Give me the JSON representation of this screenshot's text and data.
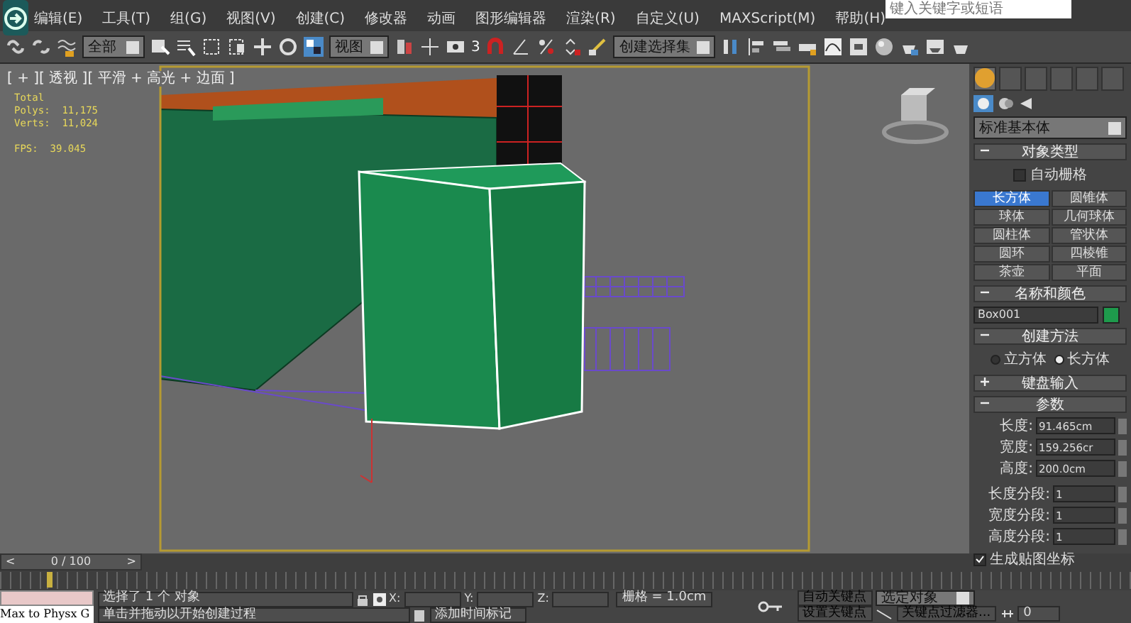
{
  "title_bar": {
    "search_placeholder": "键入关键字或短语"
  },
  "menu": [
    "编辑(E)",
    "工具(T)",
    "组(G)",
    "视图(V)",
    "创建(C)",
    "修改器",
    "动画",
    "图形编辑器",
    "渲染(R)",
    "自定义(U)",
    "MAXScript(M)",
    "帮助(H)"
  ],
  "toolbar": {
    "selection_filter": "全部",
    "reference_coord": "视图",
    "selection_set": "创建选择集",
    "snap_count": "3"
  },
  "viewport": {
    "label": "[ + ][ 透视 ][ 平滑 + 高光 + 边面 ]",
    "stats": [
      "Total",
      "Polys:  11,175",
      "Verts:  11,024"
    ],
    "fps": "FPS:  39.045"
  },
  "command_panel": {
    "category": "标准基本体",
    "object_type": {
      "title": "对象类型",
      "auto_grid": {
        "label": "自动栅格",
        "checked": false
      },
      "buttons": [
        {
          "label": "长方体",
          "selected": true
        },
        {
          "label": "圆锥体",
          "selected": false
        },
        {
          "label": "球体",
          "selected": false
        },
        {
          "label": "几何球体",
          "selected": false
        },
        {
          "label": "圆柱体",
          "selected": false
        },
        {
          "label": "管状体",
          "selected": false
        },
        {
          "label": "圆环",
          "selected": false
        },
        {
          "label": "四棱锥",
          "selected": false
        },
        {
          "label": "茶壶",
          "selected": false
        },
        {
          "label": "平面",
          "selected": false
        }
      ]
    },
    "name_color": {
      "title": "名称和颜色",
      "name": "Box001",
      "color": "#1e9a4c"
    },
    "creation_method": {
      "title": "创建方法",
      "options": [
        {
          "label": "立方体",
          "selected": false
        },
        {
          "label": "长方体",
          "selected": true
        }
      ]
    },
    "keyboard_entry": {
      "title": "键盘输入",
      "expanded": false
    },
    "parameters": {
      "title": "参数",
      "expanded": true,
      "fields": [
        {
          "label": "长度:",
          "value": "91.465cm"
        },
        {
          "label": "宽度:",
          "value": "159.256cr"
        },
        {
          "label": "高度:",
          "value": "200.0cm"
        }
      ],
      "segments": [
        {
          "label": "长度分段:",
          "value": "1"
        },
        {
          "label": "宽度分段:",
          "value": "1"
        },
        {
          "label": "高度分段:",
          "value": "1"
        }
      ],
      "gen_mapping": {
        "label": "生成贴图坐标",
        "checked": true
      }
    }
  },
  "timeline": {
    "position": "0 / 100",
    "level": 0,
    "prev": "<",
    "next": ">"
  },
  "status": {
    "script_output": "Max to Physx G",
    "selection": "选择了 1 个 对象",
    "prompt": "单击并拖动以开始创建过程",
    "x_label": "X:",
    "y_label": "Y:",
    "z_label": "Z:",
    "grid": "栅格 = 1.0cm",
    "add_time_tag": "添加时间标记",
    "auto_key": "自动关键点",
    "set_key": "设置关键点",
    "key_mode": "选定对象",
    "key_filters": "关键点过滤器...",
    "frame": "0"
  }
}
